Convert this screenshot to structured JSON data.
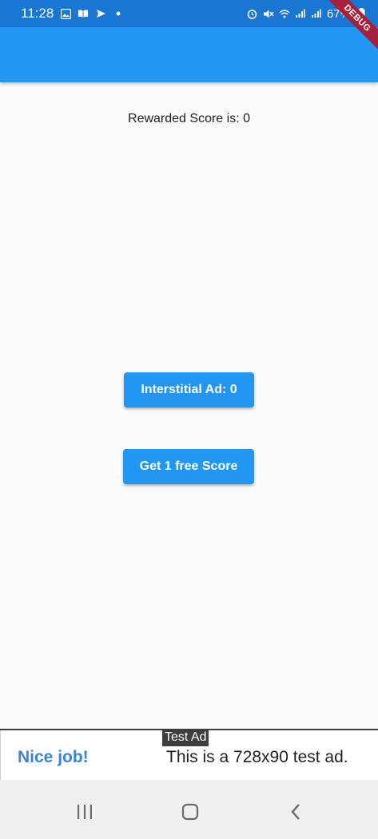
{
  "status_bar": {
    "time": "11:28",
    "battery": "67%"
  },
  "debug_banner": "DEBUG",
  "main": {
    "score_text": "Rewarded Score is: 0",
    "interstitial_button": "Interstitial Ad: 0",
    "reward_button": "Get 1 free Score"
  },
  "ad": {
    "label": "Test Ad",
    "headline": "Nice job!",
    "body": "This is a 728x90 test ad."
  },
  "colors": {
    "status_bar": "#1976d2",
    "app_bar": "#2196f3",
    "button": "#2196f3",
    "debug_banner": "#a3213a",
    "ad_headline": "#3a84d8"
  },
  "icons": {
    "status_left": [
      "image-icon",
      "book-icon",
      "send-icon",
      "dot-icon"
    ],
    "status_right": [
      "alarm-icon",
      "mute-icon",
      "wifi-icon",
      "signal-icon",
      "signal-icon",
      "battery-icon"
    ],
    "nav": [
      "recent-apps-icon",
      "home-icon",
      "back-icon"
    ]
  }
}
